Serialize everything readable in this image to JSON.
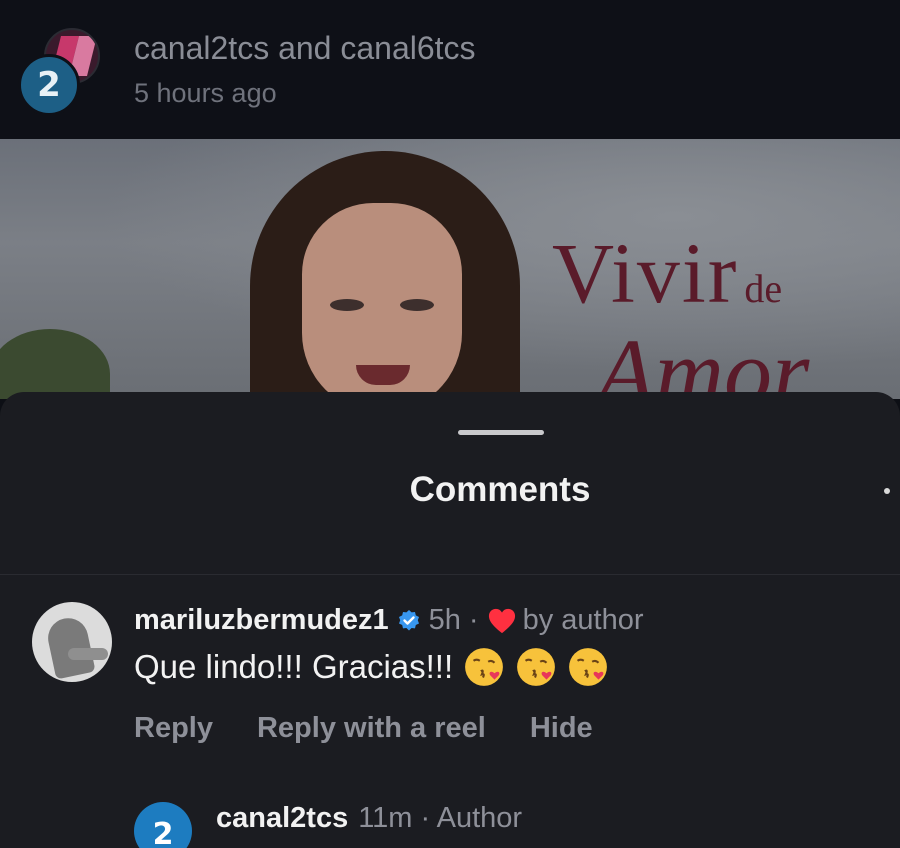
{
  "post": {
    "title": "canal2tcs and canal6tcs",
    "time": "5 hours ago",
    "avatar_number": "2"
  },
  "video": {
    "logo_line1": "Vivir",
    "logo_line1_small": "de",
    "logo_line2": "Amor"
  },
  "sheet": {
    "title": "Comments"
  },
  "comments": [
    {
      "username": "mariluzbermudez1",
      "verified": true,
      "time": "5h",
      "liked_by_author_text": "by author",
      "text": "Que lindo!!! Gracias!!!",
      "emojis": [
        "kissing-face-icon",
        "kissing-face-icon",
        "kissing-face-icon"
      ],
      "actions": [
        "Reply",
        "Reply with a reel",
        "Hide"
      ]
    }
  ],
  "reply": {
    "avatar_number": "2",
    "username": "canal2tcs",
    "meta": "11m · Author"
  },
  "colors": {
    "verified_blue": "#3897f0",
    "heart_red": "#ff3040",
    "sheet_bg": "#1b1c21"
  }
}
